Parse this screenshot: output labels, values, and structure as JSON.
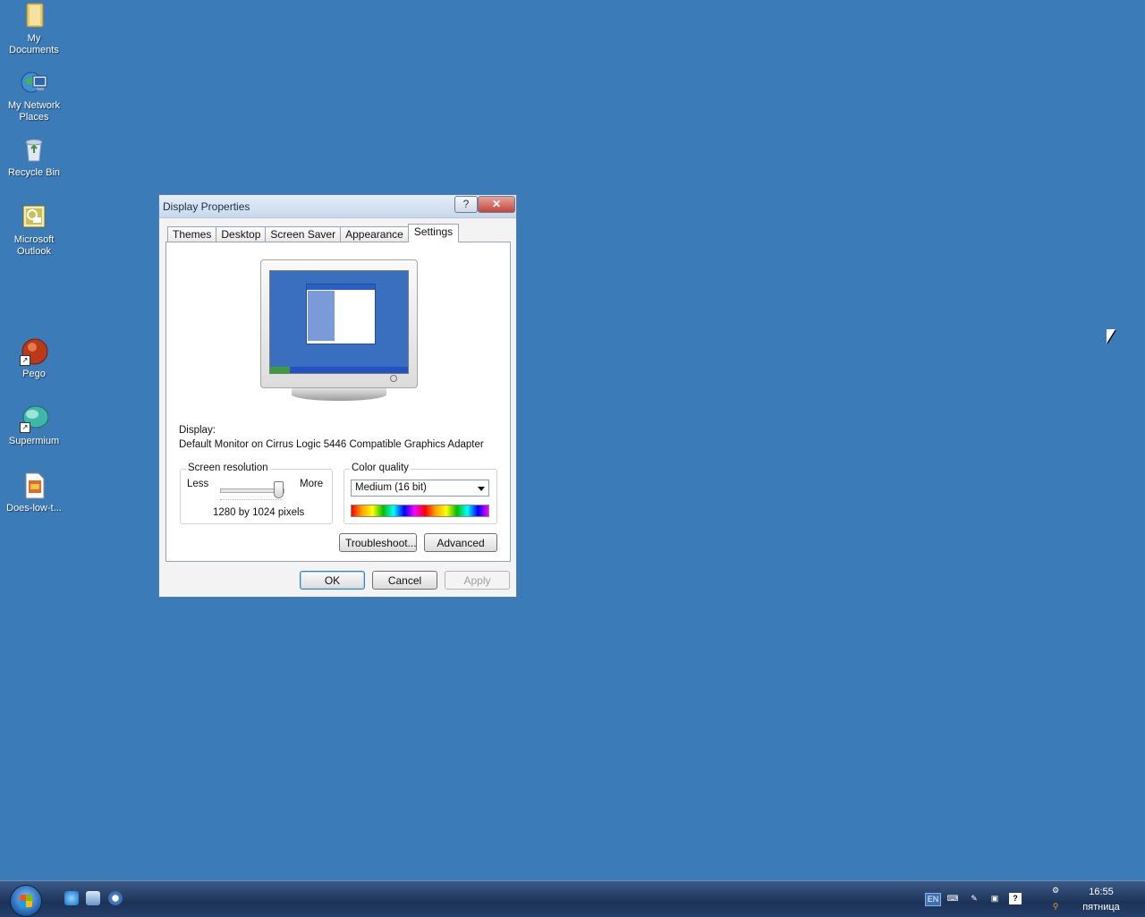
{
  "desktop": {
    "icons": [
      {
        "label": "My Documents"
      },
      {
        "label": "My Network Places"
      },
      {
        "label": "Recycle Bin"
      },
      {
        "label": "Microsoft Outlook"
      },
      {
        "label": "Pego"
      },
      {
        "label": "Supermium"
      },
      {
        "label": "Does-low-t..."
      }
    ],
    "background_color": "#3a7bb8"
  },
  "dialog": {
    "title": "Display Properties",
    "help_label": "?",
    "close_label": "✕",
    "tabs": [
      {
        "label": "Themes"
      },
      {
        "label": "Desktop"
      },
      {
        "label": "Screen Saver"
      },
      {
        "label": "Appearance"
      },
      {
        "label": "Settings"
      }
    ],
    "active_tab": "Settings",
    "display_label": "Display:",
    "display_value": "Default Monitor on Cirrus Logic 5446 Compatible Graphics Adapter",
    "resolution": {
      "title": "Screen resolution",
      "less": "Less",
      "more": "More",
      "value_text": "1280 by 1024 pixels",
      "slider_level": 1.0
    },
    "color_quality": {
      "title": "Color quality",
      "selected": "Medium (16 bit)"
    },
    "buttons": {
      "troubleshoot": "Troubleshoot...",
      "advanced": "Advanced",
      "ok": "OK",
      "cancel": "Cancel",
      "apply": "Apply"
    }
  },
  "taskbar": {
    "language": "EN",
    "time": "16:55",
    "day": "пятница"
  }
}
